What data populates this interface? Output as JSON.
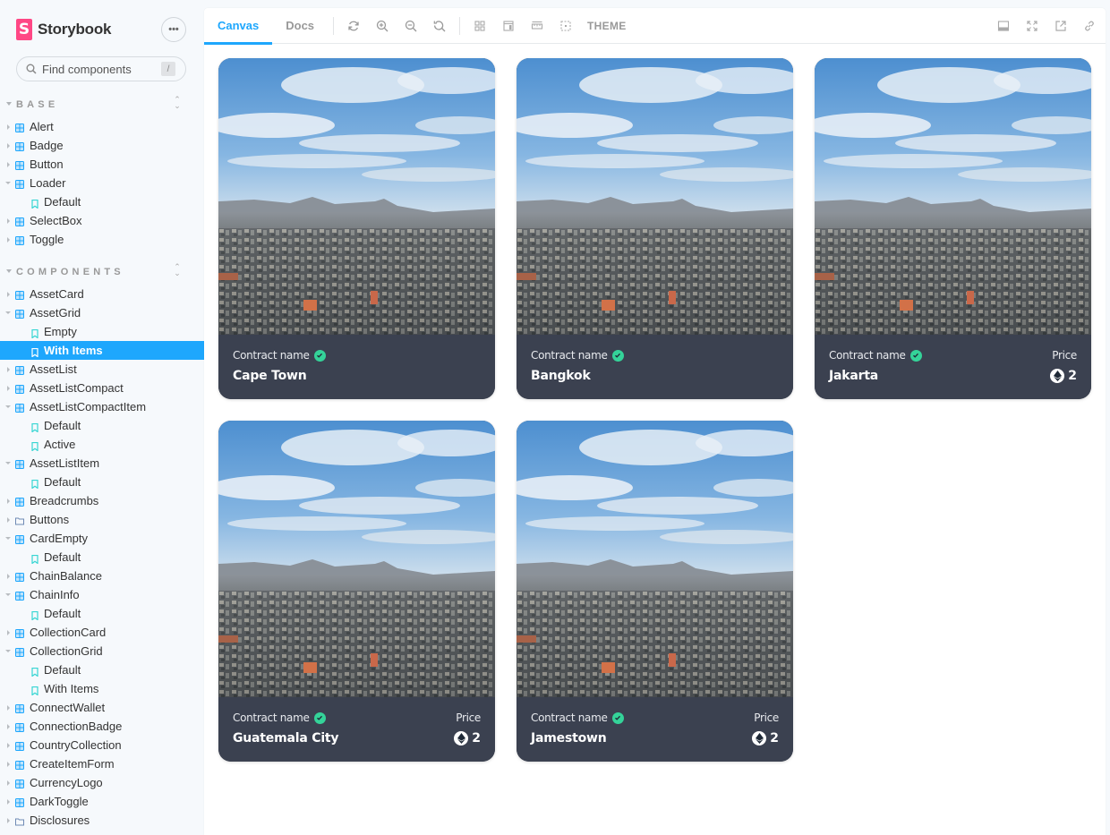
{
  "brand": {
    "name": "Storybook",
    "logo_letter": "S",
    "color": "#ff4785"
  },
  "sidebar": {
    "menu_label": "•••",
    "search": {
      "placeholder": "Find components",
      "value": "",
      "shortcut": "/"
    },
    "sections": [
      {
        "title": "BASE",
        "items": [
          {
            "label": "Alert",
            "type": "component",
            "expanded": false
          },
          {
            "label": "Badge",
            "type": "component",
            "expanded": false
          },
          {
            "label": "Button",
            "type": "component",
            "expanded": false
          },
          {
            "label": "Loader",
            "type": "component",
            "expanded": true
          },
          {
            "label": "Default",
            "type": "story"
          },
          {
            "label": "SelectBox",
            "type": "component",
            "expanded": false
          },
          {
            "label": "Toggle",
            "type": "component",
            "expanded": false
          }
        ]
      },
      {
        "title": "COMPONENTS",
        "items": [
          {
            "label": "AssetCard",
            "type": "component",
            "expanded": false
          },
          {
            "label": "AssetGrid",
            "type": "component",
            "expanded": true
          },
          {
            "label": "Empty",
            "type": "story"
          },
          {
            "label": "With Items",
            "type": "story",
            "selected": true
          },
          {
            "label": "AssetList",
            "type": "component",
            "expanded": false
          },
          {
            "label": "AssetListCompact",
            "type": "component",
            "expanded": false
          },
          {
            "label": "AssetListCompactItem",
            "type": "component",
            "expanded": true
          },
          {
            "label": "Default",
            "type": "story"
          },
          {
            "label": "Active",
            "type": "story"
          },
          {
            "label": "AssetListItem",
            "type": "component",
            "expanded": true
          },
          {
            "label": "Default",
            "type": "story"
          },
          {
            "label": "Breadcrumbs",
            "type": "component",
            "expanded": false
          },
          {
            "label": "Buttons",
            "type": "folder",
            "expanded": false
          },
          {
            "label": "CardEmpty",
            "type": "component",
            "expanded": true
          },
          {
            "label": "Default",
            "type": "story"
          },
          {
            "label": "ChainBalance",
            "type": "component",
            "expanded": false
          },
          {
            "label": "ChainInfo",
            "type": "component",
            "expanded": true
          },
          {
            "label": "Default",
            "type": "story"
          },
          {
            "label": "CollectionCard",
            "type": "component",
            "expanded": false
          },
          {
            "label": "CollectionGrid",
            "type": "component",
            "expanded": true
          },
          {
            "label": "Default",
            "type": "story"
          },
          {
            "label": "With Items",
            "type": "story"
          },
          {
            "label": "ConnectWallet",
            "type": "component",
            "expanded": false
          },
          {
            "label": "ConnectionBadge",
            "type": "component",
            "expanded": false
          },
          {
            "label": "CountryCollection",
            "type": "component",
            "expanded": false
          },
          {
            "label": "CreateItemForm",
            "type": "component",
            "expanded": false
          },
          {
            "label": "CurrencyLogo",
            "type": "component",
            "expanded": false
          },
          {
            "label": "DarkToggle",
            "type": "component",
            "expanded": false
          },
          {
            "label": "Disclosures",
            "type": "folder",
            "expanded": false
          }
        ]
      }
    ]
  },
  "toolbar": {
    "tabs": [
      {
        "label": "Canvas",
        "active": true
      },
      {
        "label": "Docs",
        "active": false
      }
    ],
    "tools": [
      "reload-icon",
      "zoom-in-icon",
      "zoom-out-icon",
      "zoom-reset-icon",
      "grid-icon",
      "background-icon",
      "measure-icon",
      "outline-icon"
    ],
    "theme_label": "THEME",
    "right_tools": [
      "panel-icon",
      "fullscreen-icon",
      "open-new-tab-icon",
      "copy-link-icon"
    ],
    "accent": "#1ea7fd"
  },
  "cards": [
    {
      "contract_label": "Contract name",
      "name": "Cape Town",
      "verified": true,
      "price_label": null,
      "price": null
    },
    {
      "contract_label": "Contract name",
      "name": "Bangkok",
      "verified": true,
      "price_label": null,
      "price": null
    },
    {
      "contract_label": "Contract name",
      "name": "Jakarta",
      "verified": true,
      "price_label": "Price",
      "price": "2",
      "currency": "ETH"
    },
    {
      "contract_label": "Contract name",
      "name": "Guatemala City",
      "verified": true,
      "price_label": "Price",
      "price": "2",
      "currency": "ETH"
    },
    {
      "contract_label": "Contract name",
      "name": "Jamestown",
      "verified": true,
      "price_label": "Price",
      "price": "2",
      "currency": "ETH"
    }
  ],
  "colors": {
    "card_bg": "#3b4150",
    "verified": "#34d399",
    "selected_bg": "#1ea7fd"
  }
}
